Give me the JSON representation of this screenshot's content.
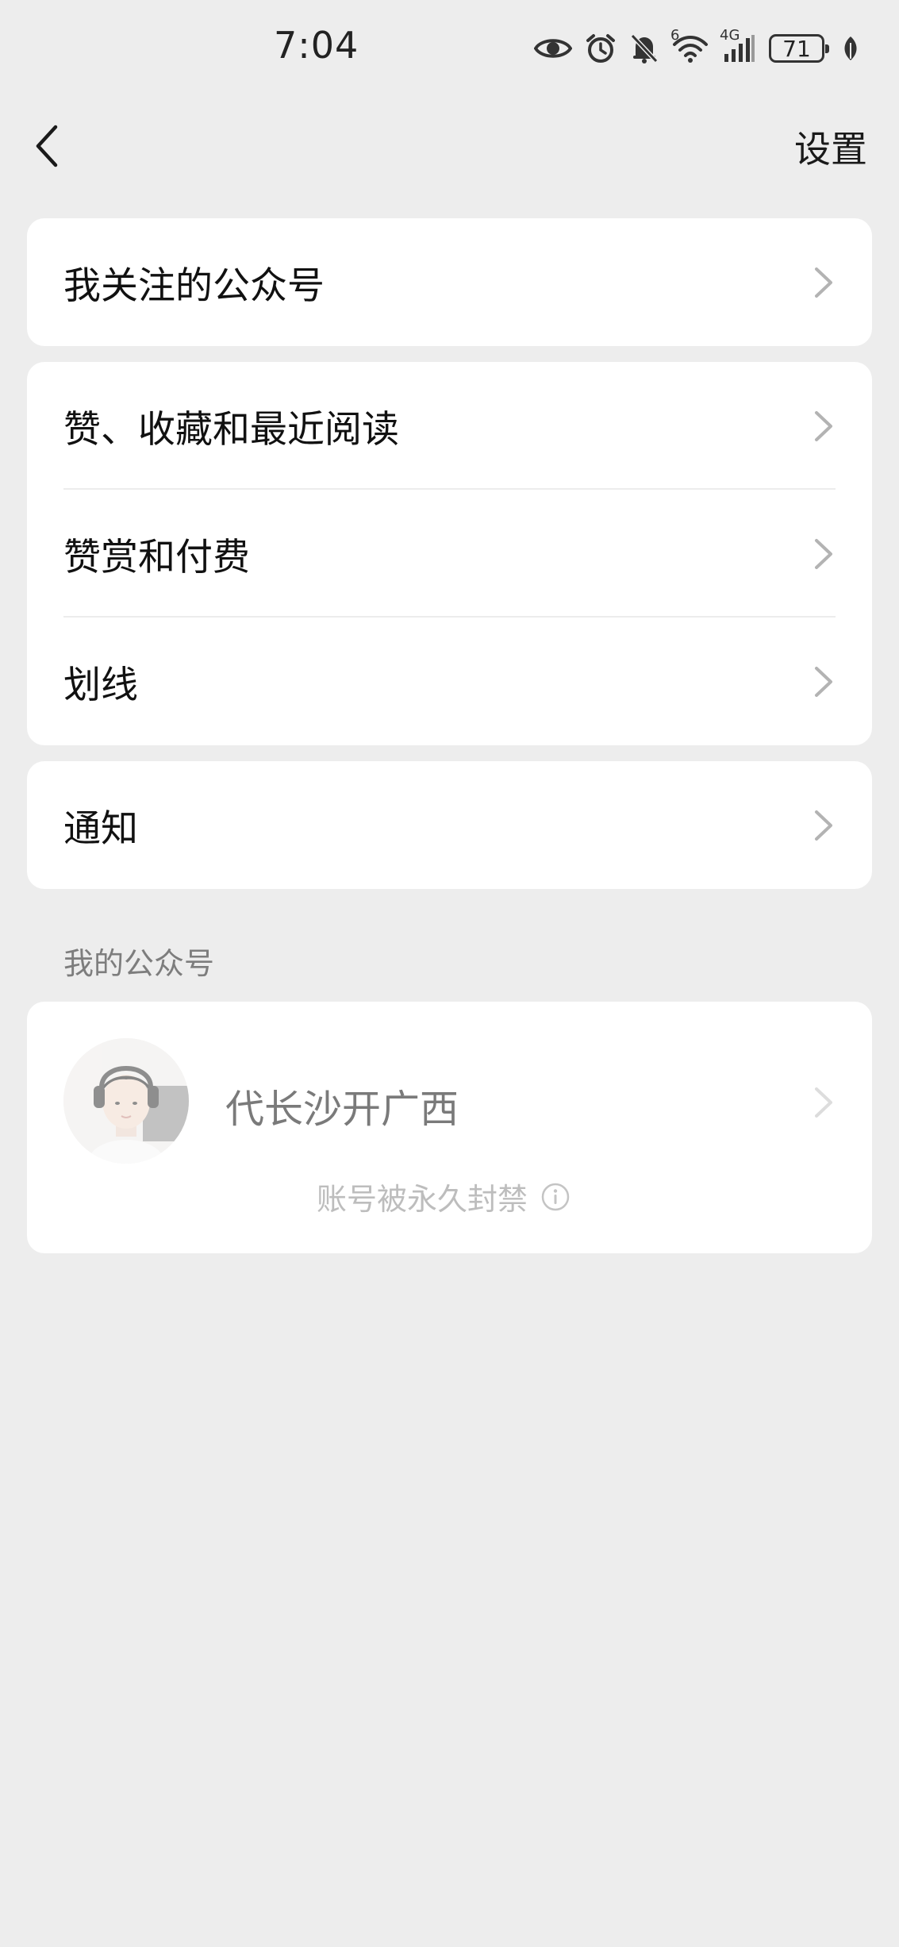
{
  "status_bar": {
    "time": "7:04",
    "network_sup": "6",
    "network_label": "4G",
    "battery": "71",
    "icons": [
      "eye-icon",
      "alarm-icon",
      "bell-off-icon",
      "wifi-icon",
      "signal-icon",
      "battery-icon",
      "leaf-icon"
    ]
  },
  "nav": {
    "back_icon": "chevron-left-icon",
    "settings_label": "设置"
  },
  "groups": [
    {
      "items": [
        {
          "label": "我关注的公众号"
        }
      ]
    },
    {
      "items": [
        {
          "label": "赞、收藏和最近阅读"
        },
        {
          "label": "赞赏和付费"
        },
        {
          "label": "划线"
        }
      ]
    },
    {
      "items": [
        {
          "label": "通知"
        }
      ]
    }
  ],
  "my_accounts": {
    "section_title": "我的公众号",
    "account": {
      "name": "代长沙开广西",
      "status": "账号被永久封禁",
      "status_icon": "info-icon"
    }
  },
  "colors": {
    "background": "#ededed",
    "card": "#ffffff",
    "primary_text": "#111111",
    "secondary_text": "#7d7d7d",
    "disabled_text": "#bdbdbd"
  }
}
